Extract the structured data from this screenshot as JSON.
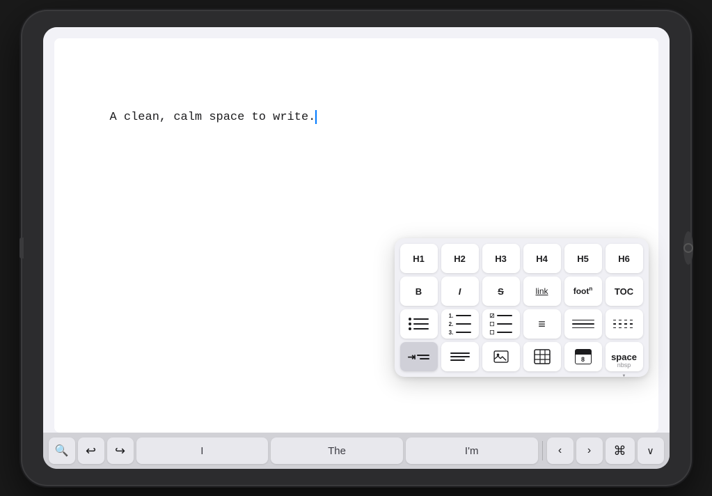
{
  "device": {
    "screen_bg": "#f2f2f7"
  },
  "editor": {
    "text": "A clean, calm space to write.",
    "cursor_visible": true
  },
  "toolbar": {
    "rows": [
      [
        {
          "id": "h1",
          "label": "H1",
          "type": "text"
        },
        {
          "id": "h2",
          "label": "H2",
          "type": "text"
        },
        {
          "id": "h3",
          "label": "H3",
          "type": "text"
        },
        {
          "id": "h4",
          "label": "H4",
          "type": "text"
        },
        {
          "id": "h5",
          "label": "H5",
          "type": "text"
        },
        {
          "id": "h6",
          "label": "H6",
          "type": "text"
        }
      ],
      [
        {
          "id": "bold",
          "label": "B",
          "type": "bold"
        },
        {
          "id": "italic",
          "label": "I",
          "type": "italic"
        },
        {
          "id": "strikethrough",
          "label": "S",
          "type": "strike"
        },
        {
          "id": "link",
          "label": "link",
          "type": "underline-link"
        },
        {
          "id": "footnote",
          "label": "foot",
          "type": "footnote"
        },
        {
          "id": "toc",
          "label": "TOC",
          "type": "text"
        }
      ],
      [
        {
          "id": "bullet-list",
          "label": "",
          "type": "bullet-list"
        },
        {
          "id": "numbered-list",
          "label": "",
          "type": "numbered-list"
        },
        {
          "id": "check-list",
          "label": "",
          "type": "check-list"
        },
        {
          "id": "paragraph",
          "label": "¶",
          "type": "para"
        },
        {
          "id": "separator1",
          "label": "",
          "type": "separator"
        },
        {
          "id": "separator2",
          "label": "",
          "type": "separator-dashed"
        }
      ],
      [
        {
          "id": "indent",
          "label": "",
          "type": "indent",
          "active": true
        },
        {
          "id": "text-block",
          "label": "",
          "type": "text-block"
        },
        {
          "id": "image",
          "label": "",
          "type": "image"
        },
        {
          "id": "table",
          "label": "",
          "type": "table"
        },
        {
          "id": "calendar",
          "label": "8",
          "type": "calendar"
        },
        {
          "id": "space",
          "label": "space",
          "sublabel": "nbsp",
          "type": "space"
        }
      ]
    ]
  },
  "bottom_toolbar": {
    "search_label": "🔍",
    "undo_label": "↩",
    "redo_label": "↪",
    "word1": "I",
    "word2": "The",
    "word3": "I'm",
    "prev_label": "<",
    "next_label": ">",
    "cmd_label": "⌘",
    "expand_label": "∨"
  }
}
